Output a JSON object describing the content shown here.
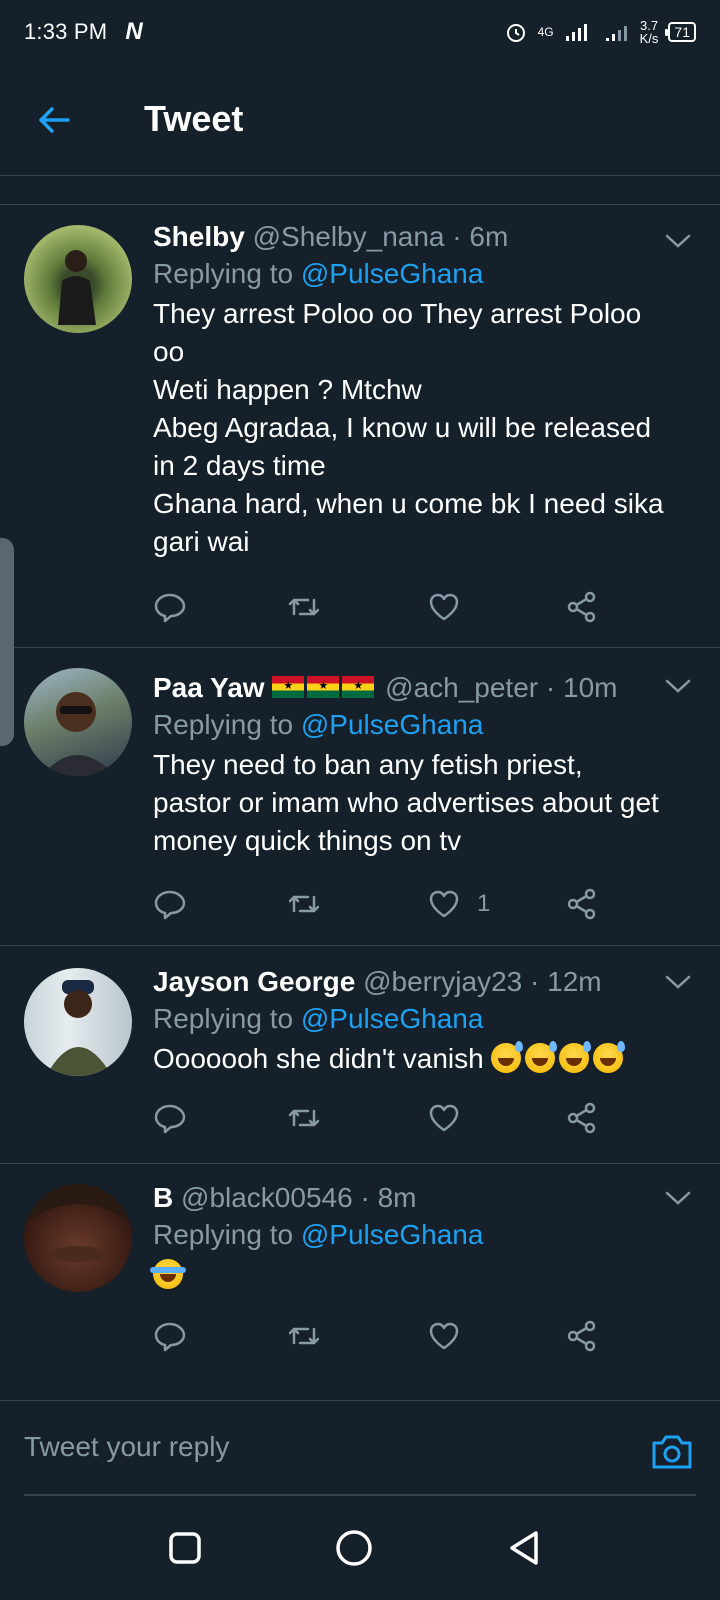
{
  "status_bar": {
    "time": "1:33 PM",
    "logo": "N",
    "network": "4G",
    "speed_value": "3.7",
    "speed_unit": "K/s",
    "battery": "71"
  },
  "header": {
    "title": "Tweet",
    "back_icon": "arrow-left-icon"
  },
  "tweets": [
    {
      "name": "Shelby",
      "handle": "@Shelby_nana",
      "time": "6m",
      "replying_label": "Replying to",
      "replying_to": "@PulseGhana",
      "lines": [
        "They arrest Poloo oo They arrest Poloo",
        "oo",
        "Weti happen ? Mtchw",
        "Abeg Agradaa, I know u will be released",
        "in 2 days time",
        "Ghana hard, when u come bk I need sika",
        "gari wai"
      ],
      "likes": ""
    },
    {
      "name": "Paa Yaw",
      "flags": "ghana-flag-x3",
      "handle": "@ach_peter",
      "time": "10m",
      "replying_label": "Replying to",
      "replying_to": "@PulseGhana",
      "lines": [
        "They need to ban any fetish priest,",
        "pastor or imam who advertises about get",
        "money quick things on tv"
      ],
      "likes": "1"
    },
    {
      "name": "Jayson George",
      "handle": "@berryjay23",
      "time": "12m",
      "replying_label": "Replying to",
      "replying_to": "@PulseGhana",
      "lines": [
        "Ooooooh she didn't vanish"
      ],
      "emoji": "grinning-sweat-emoji-x4",
      "likes": ""
    },
    {
      "name": "B",
      "handle": "@black00546",
      "time": "8m",
      "replying_label": "Replying to",
      "replying_to": "@PulseGhana",
      "lines": [],
      "emoji": "tears-of-joy-emoji",
      "likes": ""
    }
  ],
  "reply_bar": {
    "placeholder": "Tweet your reply",
    "camera_icon": "camera-icon"
  },
  "nav_bar": {
    "icons": [
      "recent-apps-icon",
      "home-icon",
      "back-icon"
    ]
  },
  "colors": {
    "background": "#15202b",
    "accent": "#1da1f2",
    "muted": "#8899a6",
    "border": "#38444d"
  }
}
